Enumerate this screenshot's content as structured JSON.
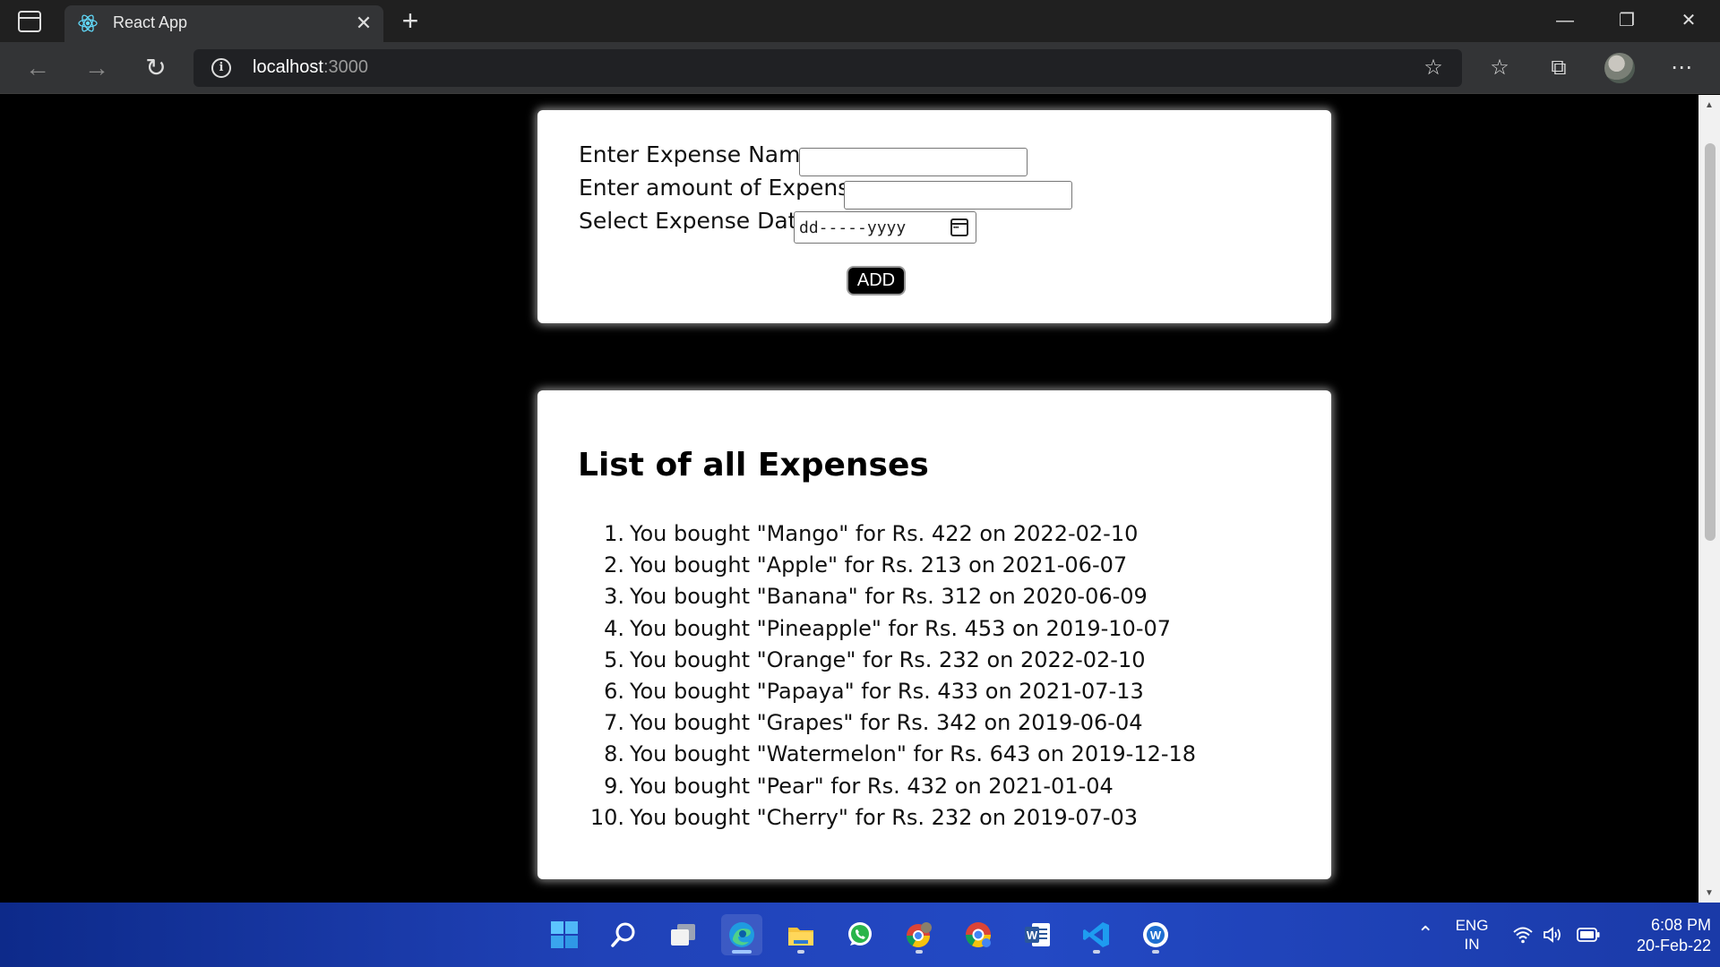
{
  "browser": {
    "tab_title": "React App",
    "url_host": "localhost",
    "url_port": ":3000"
  },
  "form": {
    "name_label": "Enter Expense Name :",
    "name_value": "",
    "amount_label": "Enter amount of Expense :",
    "amount_value": "",
    "date_label": "Select Expense Date :",
    "date_placeholder": "dd-----yyyy",
    "add_button": "ADD"
  },
  "list": {
    "title": "List of all Expenses",
    "items": [
      {
        "num": "1.",
        "text": "You bought \"Mango\" for Rs. 422 on 2022-02-10"
      },
      {
        "num": "2.",
        "text": "You bought \"Apple\" for Rs. 213 on 2021-06-07"
      },
      {
        "num": "3.",
        "text": "You bought \"Banana\" for Rs. 312 on 2020-06-09"
      },
      {
        "num": "4.",
        "text": "You bought \"Pineapple\" for Rs. 453 on 2019-10-07"
      },
      {
        "num": "5.",
        "text": "You bought \"Orange\" for Rs. 232 on 2022-02-10"
      },
      {
        "num": "6.",
        "text": "You bought \"Papaya\" for Rs. 433 on 2021-07-13"
      },
      {
        "num": "7.",
        "text": "You bought \"Grapes\" for Rs. 342 on 2019-06-04"
      },
      {
        "num": "8.",
        "text": "You bought \"Watermelon\" for Rs. 643 on 2019-12-18"
      },
      {
        "num": "9.",
        "text": "You bought \"Pear\" for Rs. 432 on 2021-01-04"
      },
      {
        "num": "10.",
        "text": "You bought \"Cherry\" for Rs. 232 on 2019-07-03"
      }
    ]
  },
  "taskbar": {
    "lang_line1": "ENG",
    "lang_line2": "IN",
    "time": "6:08 PM",
    "date": "20-Feb-22",
    "apps": [
      "start-icon",
      "search-icon",
      "task-view-icon",
      "edge-icon",
      "file-explorer-icon",
      "whatsapp-icon",
      "chrome-profile-icon",
      "chrome-icon",
      "word-icon",
      "vscode-icon",
      "app-w-icon"
    ]
  },
  "colors": {
    "page_bg": "#000000",
    "card_bg": "#ffffff",
    "chrome_dark": "#202020",
    "taskbar_blue": "#2042b8"
  }
}
